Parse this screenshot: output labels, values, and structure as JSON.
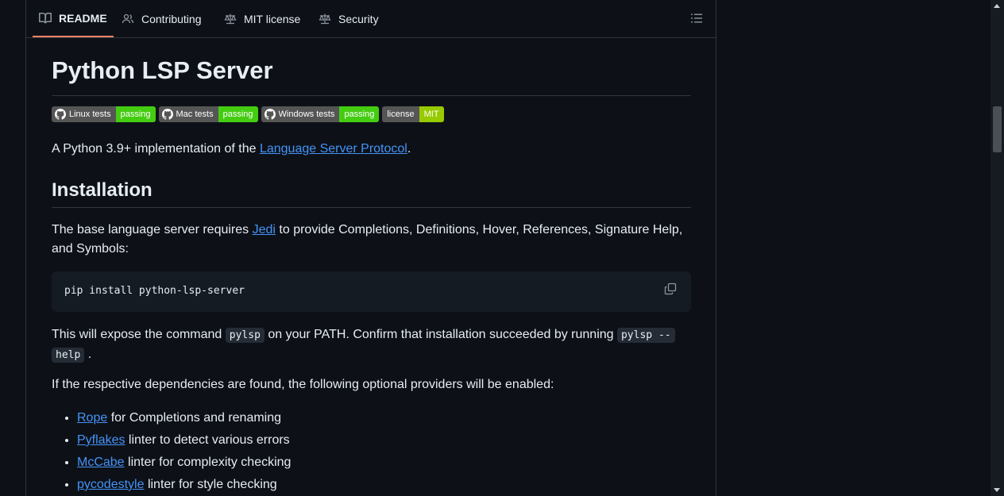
{
  "tabs": [
    {
      "label": "README",
      "icon": "book-icon",
      "active": true
    },
    {
      "label": "Contributing",
      "icon": "people-icon"
    },
    {
      "label": "MIT license",
      "icon": "law-icon"
    },
    {
      "label": "Security",
      "icon": "law-icon"
    }
  ],
  "readme": {
    "title": "Python LSP Server",
    "badges": [
      {
        "label": "Linux tests",
        "status": "passing"
      },
      {
        "label": "Mac tests",
        "status": "passing"
      },
      {
        "label": "Windows tests",
        "status": "passing"
      },
      {
        "label": "license",
        "status": "MIT"
      }
    ],
    "intro_pre": "A Python 3.9+ implementation of the ",
    "intro_link": "Language Server Protocol",
    "intro_post": ".",
    "install_heading": "Installation",
    "install_pre": "The base language server requires ",
    "install_link": "Jedi",
    "install_post": " to provide Completions, Definitions, Hover, References, Signature Help, and Symbols:",
    "code_cmd": "pip install python-lsp-server",
    "expose_pre": "This will expose the command ",
    "expose_code": "pylsp",
    "expose_mid": " on your PATH. Confirm that installation succeeded by running ",
    "expose_code2a": "pylsp --",
    "expose_code2b": "help",
    "expose_post": " .",
    "providers_text": "If the respective dependencies are found, the following optional providers will be enabled:",
    "providers": [
      {
        "link": "Rope",
        "text": " for Completions and renaming"
      },
      {
        "link": "Pyflakes",
        "text": " linter to detect various errors"
      },
      {
        "link": "McCabe",
        "text": " linter for complexity checking"
      },
      {
        "link": "pycodestyle",
        "text": " linter for style checking"
      }
    ]
  },
  "colors": {
    "accent": "#f78166",
    "link": "#4493f8",
    "badge_green": "#44cc11",
    "badge_mit": "#97ca00"
  }
}
